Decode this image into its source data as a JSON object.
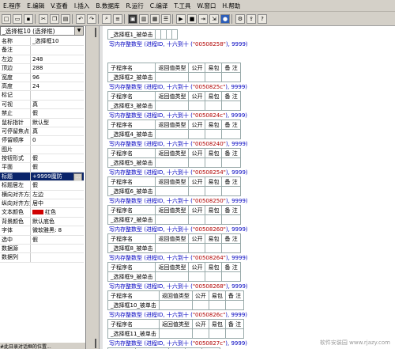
{
  "menu": [
    "E.程序",
    "E.编辑",
    "V.查看",
    "I.插入",
    "B.数据库",
    "R.运行",
    "C.编译",
    "T.工具",
    "W.窗口",
    "H.帮助"
  ],
  "object_selector": "_选择框10 (选择框)",
  "properties": [
    {
      "name": "名称",
      "value": "_选择框10"
    },
    {
      "name": "备注",
      "value": ""
    },
    {
      "name": "左边",
      "value": "248"
    },
    {
      "name": "顶边",
      "value": "288"
    },
    {
      "name": "宽度",
      "value": "96"
    },
    {
      "name": "高度",
      "value": "24"
    },
    {
      "name": "标记",
      "value": ""
    },
    {
      "name": "可视",
      "value": "真"
    },
    {
      "name": "禁止",
      "value": "假"
    },
    {
      "name": "鼠标指针",
      "value": "默认型"
    },
    {
      "name": "可停留焦点",
      "value": "真"
    },
    {
      "name": "停留顺序",
      "value": "0"
    },
    {
      "name": "图片",
      "value": ""
    },
    {
      "name": "按钮形式",
      "value": "假"
    },
    {
      "name": "平面",
      "value": "假"
    },
    {
      "name": "标题",
      "value": "+9999魔防"
    },
    {
      "name": "标题居左",
      "value": "假"
    },
    {
      "name": "横向对齐方式",
      "value": "左边"
    },
    {
      "name": "纵向对齐方式",
      "value": "居中"
    },
    {
      "name": "文本颜色",
      "value": "红色"
    },
    {
      "name": "背景颜色",
      "value": "默认底色"
    },
    {
      "name": "字体",
      "value": "微软雅黑: 8"
    },
    {
      "name": "选中",
      "value": "假"
    },
    {
      "name": "数据源",
      "value": ""
    },
    {
      "name": "数据列",
      "value": ""
    }
  ],
  "status_text": "#此日录对话框的位置...",
  "headers": [
    "子程序名",
    "返回值类型",
    "公开",
    "易包",
    "备 注"
  ],
  "call_prefix": "写内存整数型 (进程ID, 十六到十 (",
  "call_suffix": "), 9999)",
  "first_block": {
    "name": "_选择框1_被单击",
    "addr": "\"00508258\""
  },
  "blocks": [
    {
      "name": "_选择框2_被单击",
      "addr": "\"0050825c\""
    },
    {
      "name": "_选择框3_被单击",
      "addr": "\"0050824c\""
    },
    {
      "name": "_选择框4_被单击",
      "addr": "\"00508240\""
    },
    {
      "name": "_选择框5_被单击",
      "addr": "\"00508254\""
    },
    {
      "name": "_选择框6_被单击",
      "addr": "\"00508250\""
    },
    {
      "name": "_选择框7_被单击",
      "addr": "\"00508260\""
    },
    {
      "name": "_选择框8_被单击",
      "addr": "\"00508264\""
    },
    {
      "name": "_选择框9_被单击",
      "addr": "\"00508268\""
    },
    {
      "name": "_选择框10_被单击",
      "addr": "\"0050826c\""
    },
    {
      "name": "_选择框11_被单击",
      "addr": "\"0050827c\""
    }
  ],
  "last_partial": {
    "headers": [
      "子程序名",
      "返回值类型",
      "公开",
      "易包",
      "备 注"
    ]
  },
  "watermark": "软件安装园 www.rjazy.com"
}
